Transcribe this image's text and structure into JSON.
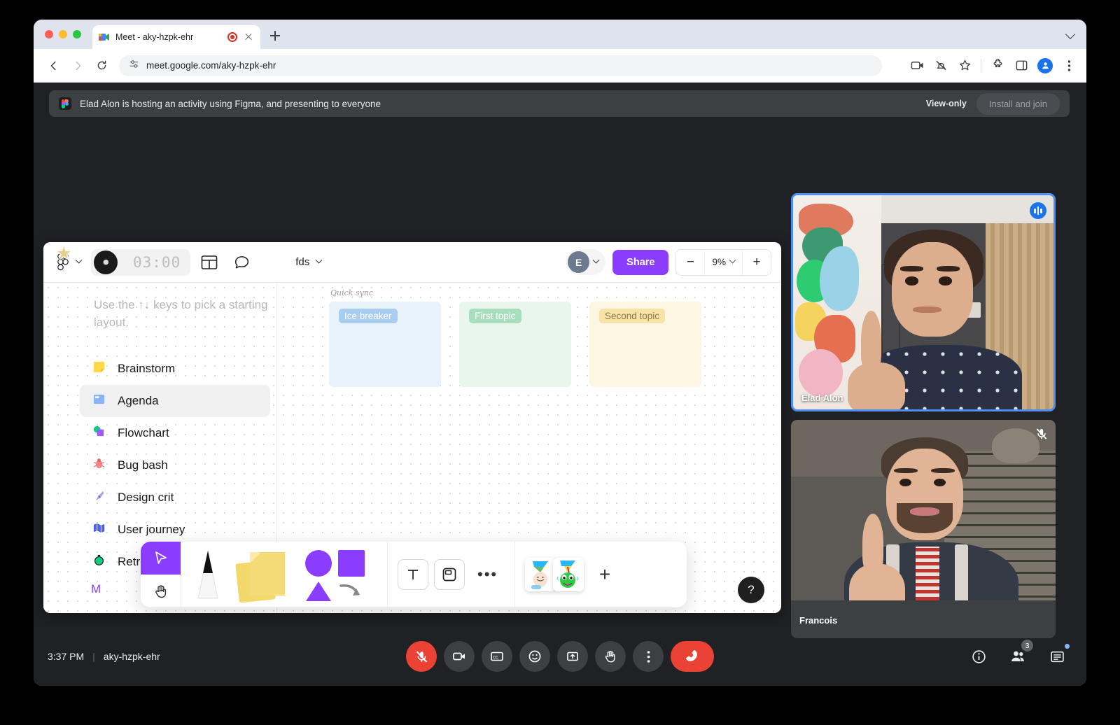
{
  "browser": {
    "tab": {
      "title": "Meet - aky-hzpk-ehr",
      "favicon": "meet-icon",
      "recording_indicator": "recording-icon",
      "close": "close-icon"
    },
    "new_tab": "new-tab-icon",
    "tabstrip_chevron": "chevron-down-icon",
    "back": "back-arrow-icon",
    "forward": "forward-arrow-icon",
    "reload": "reload-icon",
    "site_info": "site-settings-icon",
    "url": "meet.google.com/aky-hzpk-ehr",
    "omni_icons": [
      "screen-share-icon",
      "notifications-off-icon",
      "bookmark-star-icon",
      "extensions-icon",
      "side-panel-icon",
      "profile-icon",
      "more-menu-icon"
    ]
  },
  "notification": {
    "app_icon": "figma-icon",
    "message": "Elad Alon is hosting an activity using Figma, and presenting to everyone",
    "view_only_label": "View-only",
    "install_label": "Install and join"
  },
  "figma": {
    "logo": "figma-logo-icon",
    "menu_chevron": "chevron-down-icon",
    "timer": {
      "value": "03:00",
      "disc_icon": "music-disc-icon",
      "sticker_icon": "star-sticker-icon"
    },
    "layout_icon": "layout-panel-icon",
    "comment_icon": "comment-bubble-icon",
    "file_name": "fds",
    "file_chevron": "chevron-down-icon",
    "avatar_initial": "E",
    "avatar_chevron": "chevron-down-icon",
    "share_label": "Share",
    "zoom_out": "minus-icon",
    "zoom_level": "9%",
    "zoom_chevron": "chevron-down-icon",
    "zoom_in": "plus-icon",
    "hint": "Use the ↑↓ keys to pick a starting layout.",
    "layouts": [
      {
        "label": "Brainstorm",
        "emoji": "🟨",
        "icon": "sticky-note-icon",
        "active": false
      },
      {
        "label": "Agenda",
        "emoji": "🔷",
        "icon": "agenda-icon",
        "active": true
      },
      {
        "label": "Flowchart",
        "emoji": "🟩",
        "icon": "flowchart-icon",
        "active": false
      },
      {
        "label": "Bug bash",
        "emoji": "🐞",
        "icon": "bug-icon",
        "active": false
      },
      {
        "label": "Design crit",
        "emoji": "🖋",
        "icon": "pen-nib-icon",
        "active": false
      },
      {
        "label": "User journey",
        "emoji": "🗺",
        "icon": "map-icon",
        "active": false
      },
      {
        "label": "Retro",
        "emoji": "⏱",
        "icon": "stopwatch-icon",
        "active": false
      }
    ],
    "more_link": "M",
    "board": {
      "title": "Quick sync",
      "columns": [
        {
          "label": "Ice breaker",
          "color": "blue"
        },
        {
          "label": "First topic",
          "color": "green"
        },
        {
          "label": "Second topic",
          "color": "yellow"
        }
      ]
    },
    "tools": {
      "cursor": "cursor-arrow-icon",
      "hand": "hand-pan-icon",
      "pen": "pen-tool-icon",
      "sticky": "sticky-notes-icon",
      "shapes": "shapes-icon",
      "text": "text-tool-icon",
      "frame": "frame-tool-icon",
      "more": "more-tools-icon",
      "sticker_1": "party-face-sticker",
      "sticker_2": "party-monster-sticker",
      "add": "add-sticker-icon"
    },
    "help": "?"
  },
  "participants": [
    {
      "name": "Elad Alon",
      "status": "speaking",
      "badge_icon": "speaking-indicator-icon"
    },
    {
      "name": "Francois",
      "status": "muted",
      "badge_icon": "mic-off-icon"
    }
  ],
  "meeting": {
    "time": "3:37 PM",
    "code": "aky-hzpk-ehr",
    "controls": [
      {
        "name": "microphone-toggle",
        "icon": "mic-off-icon",
        "state": "muted"
      },
      {
        "name": "camera-toggle",
        "icon": "video-camera-icon",
        "state": "off"
      },
      {
        "name": "captions-toggle",
        "icon": "closed-captions-icon",
        "state": "off"
      },
      {
        "name": "emoji-reactions",
        "icon": "emoji-smile-icon",
        "state": "off"
      },
      {
        "name": "present-screen",
        "icon": "present-screen-icon",
        "state": "off"
      },
      {
        "name": "raise-hand",
        "icon": "raise-hand-icon",
        "state": "off"
      },
      {
        "name": "more-options",
        "icon": "more-vertical-icon",
        "state": "off"
      },
      {
        "name": "leave-call",
        "icon": "hang-up-icon",
        "state": "danger"
      }
    ],
    "right_controls": [
      {
        "name": "meeting-details",
        "icon": "info-icon",
        "badge": ""
      },
      {
        "name": "participants-panel",
        "icon": "people-icon",
        "badge": "3"
      },
      {
        "name": "chat-panel",
        "icon": "chat-icon",
        "badge": ""
      }
    ]
  }
}
